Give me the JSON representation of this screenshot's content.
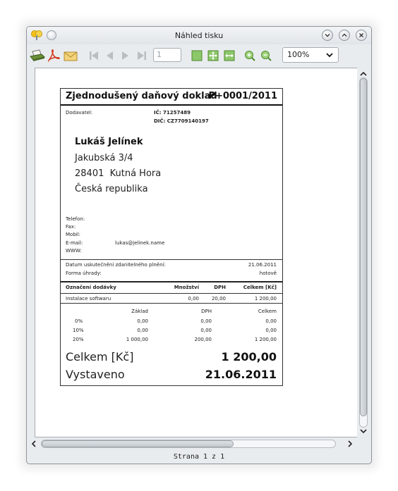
{
  "window": {
    "title": "Náhled tisku",
    "status": "Strana 1 z 1"
  },
  "toolbar": {
    "page_number": "1",
    "zoom": "100%"
  },
  "invoice": {
    "title": "Zjednodušený daňový doklad",
    "number": "P+0001/2011",
    "supplier_label": "Dodavatel:",
    "ic_label": "IČ:",
    "ic": "71257489",
    "dic_label": "DIČ:",
    "dic": "CZ7709140197",
    "name": "Lukáš Jelínek",
    "street": "Jakubská 3/4",
    "city": "28401  Kutná Hora",
    "country": "Česká republika",
    "contact": {
      "phone_label": "Telefon:",
      "fax_label": "Fax:",
      "mobile_label": "Mobil:",
      "email_label": "E-mail:",
      "email": "lukas@jelinek.name",
      "www_label": "WWW:"
    },
    "taxable_date_label": "Datum uskutečnění zdanitelného plnění:",
    "taxable_date": "21.06.2011",
    "payment_label": "Forma úhrady:",
    "payment": "hotově",
    "items_header": {
      "name": "Označení dodávky",
      "qty": "Množství",
      "vat": "DPH",
      "total": "Celkem [Kč]"
    },
    "items": [
      {
        "name": "Instalace softwaru",
        "qty": "0,00",
        "vat": "20,00",
        "total": "1 200,00"
      }
    ],
    "summary_header": {
      "base": "Základ",
      "vat": "DPH",
      "total": "Celkem"
    },
    "summary": [
      {
        "rate": "0%",
        "base": "0,00",
        "vat": "0,00",
        "total": "0,00"
      },
      {
        "rate": "10%",
        "base": "0,00",
        "vat": "0,00",
        "total": "0,00"
      },
      {
        "rate": "20%",
        "base": "1 000,00",
        "vat": "200,00",
        "total": "1 200,00"
      }
    ],
    "grand_total_label": "Celkem [Kč]",
    "grand_total": "1 200,00",
    "issued_label": "Vystaveno",
    "issued_date": "21.06.2011"
  }
}
